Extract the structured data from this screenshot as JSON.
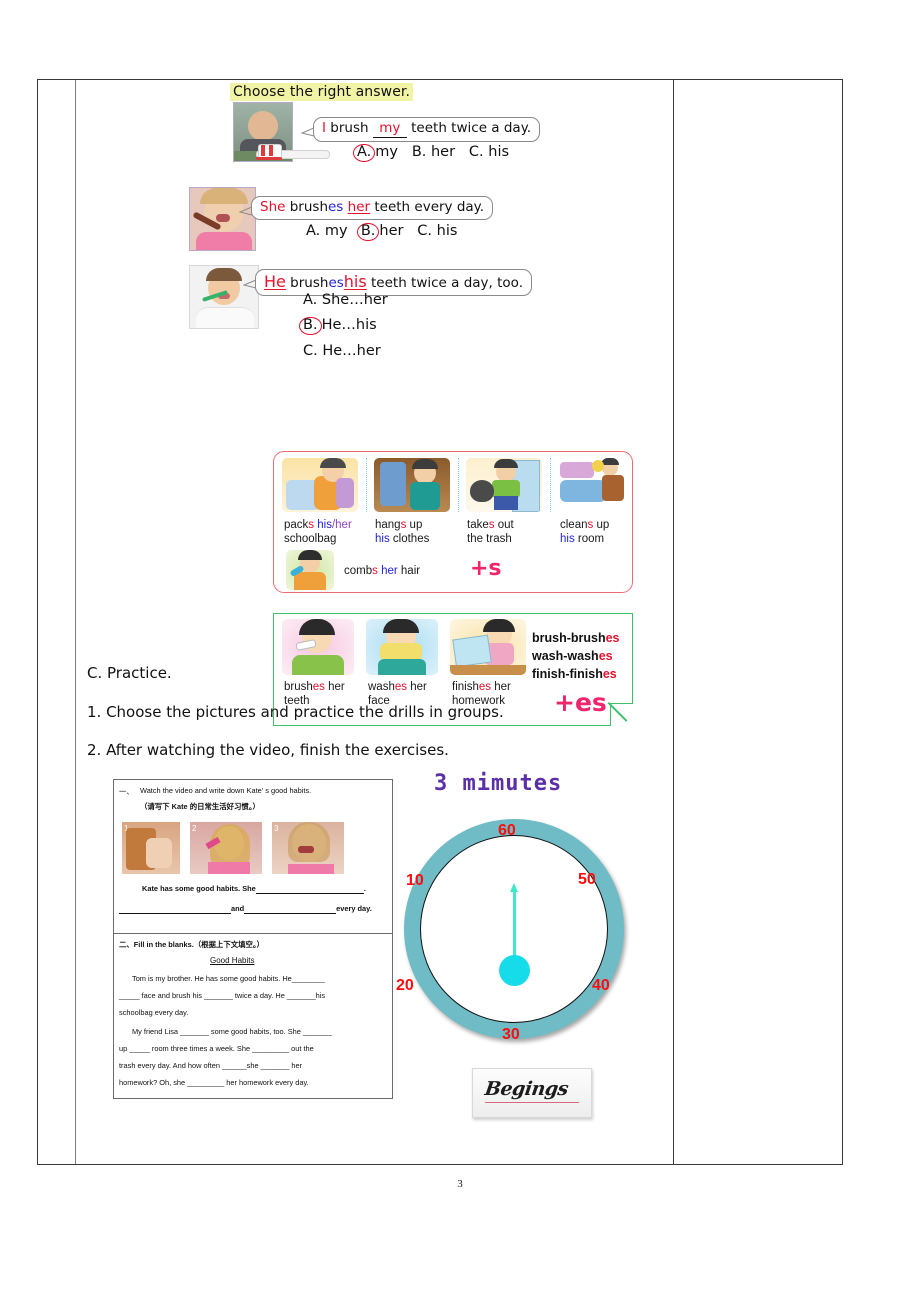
{
  "page": {
    "number": "3"
  },
  "section_title": "Choose the right answer.",
  "questions": [
    {
      "id": "q1",
      "sentence_pre": "I",
      "sentence_word": "brush",
      "blank_answer": "my",
      "sentence_post": "teeth twice a day.",
      "options": [
        "A.",
        "my",
        "B. her",
        "C. his"
      ],
      "correct": "A.",
      "photo_alt": "woman-photo"
    },
    {
      "id": "q2",
      "subject": "She",
      "verb_stem": "brush",
      "verb_suffix": "es",
      "blank_answer": "her",
      "sentence_post": "teeth every day.",
      "options": [
        "A. my",
        "B.",
        "her",
        "C. his"
      ],
      "correct": "B.",
      "photo_alt": "girl-brushing-teeth-photo"
    },
    {
      "id": "q3",
      "subject": "He",
      "verb_stem": "brush",
      "verb_suffix": "es",
      "blank_answer": "his",
      "sentence_post": "teeth twice a day, too.",
      "options": [
        "A. She…her",
        "B.",
        "He…his",
        "C. He…her"
      ],
      "correct": "B.",
      "photo_alt": "boy-brushing-teeth-photo"
    }
  ],
  "plus_s_box": {
    "marker": "+s",
    "items": [
      {
        "verb_stem": "pack",
        "verb_suffix": "s",
        "pron1": "his",
        "sep": "/",
        "pron2": "her",
        "tail": "schoolbag",
        "img": "packs-schoolbag-image"
      },
      {
        "verb_stem": "hang",
        "verb_suffix": "s",
        "mid": "up",
        "pron1": "his",
        "tail": "clothes",
        "img": "hangs-up-clothes-image"
      },
      {
        "verb_stem": "take",
        "verb_suffix": "s",
        "mid": "out",
        "tail": "the trash",
        "img": "takes-out-trash-image"
      },
      {
        "verb_stem": "clean",
        "verb_suffix": "s",
        "mid": "up",
        "pron1": "his",
        "tail": "room",
        "img": "cleans-up-room-image"
      },
      {
        "verb_stem": "comb",
        "verb_suffix": "s",
        "pron1": "her",
        "tail": "hair",
        "img": "combs-hair-image"
      }
    ]
  },
  "plus_es_box": {
    "marker": "+es",
    "items": [
      {
        "verb_stem": "brush",
        "verb_suffix": "es",
        "tail": "her teeth",
        "img": "brushes-teeth-image"
      },
      {
        "verb_stem": "wash",
        "verb_suffix": "es",
        "tail": "her face",
        "img": "washes-face-image"
      },
      {
        "verb_stem": "finish",
        "verb_suffix": "es",
        "tail": "her homework",
        "img": "finishes-homework-image"
      }
    ],
    "rules": [
      {
        "stem": "brush-brush",
        "suffix": "es"
      },
      {
        "stem": "wash-wash",
        "suffix": "es"
      },
      {
        "stem": "finish-finish",
        "suffix": "es"
      }
    ]
  },
  "practice": {
    "heading": "C. Practice.",
    "steps": [
      "1. Choose the pictures and practice the drills in groups.",
      "2. After watching the video, finish the exercises."
    ]
  },
  "worksheet": {
    "part1": {
      "number": "一、",
      "title": "Watch the video and write down   Kate' s good habits.",
      "subtitle": "（请写下 Kate 的日常生活好习惯。）",
      "images": [
        {
          "label": "1",
          "alt": "kate-packing-schoolbag"
        },
        {
          "label": "2",
          "alt": "kate-combing-hair"
        },
        {
          "label": "3",
          "alt": "kate-brushing-teeth"
        }
      ],
      "line1": "Kate has some good habits. She",
      "line1_end": ".",
      "line2_mid": "and",
      "line2_end": "every day."
    },
    "part2": {
      "number": "二、",
      "title": "Fill in the blanks.（根据上下文填空。）",
      "heading": "Good Habits",
      "lines": [
        "Tom is my brother. He has some good habits. He________",
        "_____ face and brush his _______ twice a day. He _______his",
        "schoolbag every day.",
        "My friend Lisa _______ some good habits, too. She _______",
        "up _____ room   three times a week. She _________ out   the",
        "trash every day. And how often ______she _______  her",
        "homework? Oh, she _________ her homework every day."
      ]
    }
  },
  "timer": {
    "title": "3 mimutes",
    "marks": [
      {
        "value": "60",
        "pos": "top"
      },
      {
        "value": "50",
        "pos": "upper-right"
      },
      {
        "value": "40",
        "pos": "lower-right"
      },
      {
        "value": "30",
        "pos": "bottom"
      },
      {
        "value": "20",
        "pos": "lower-left"
      },
      {
        "value": "10",
        "pos": "upper-left"
      }
    ],
    "button_label": "Begings",
    "ring_color": "#6fbcc6",
    "hub_color": "#16dbe8",
    "number_color": "#fc0d0d",
    "title_color": "#5b2fa8"
  }
}
